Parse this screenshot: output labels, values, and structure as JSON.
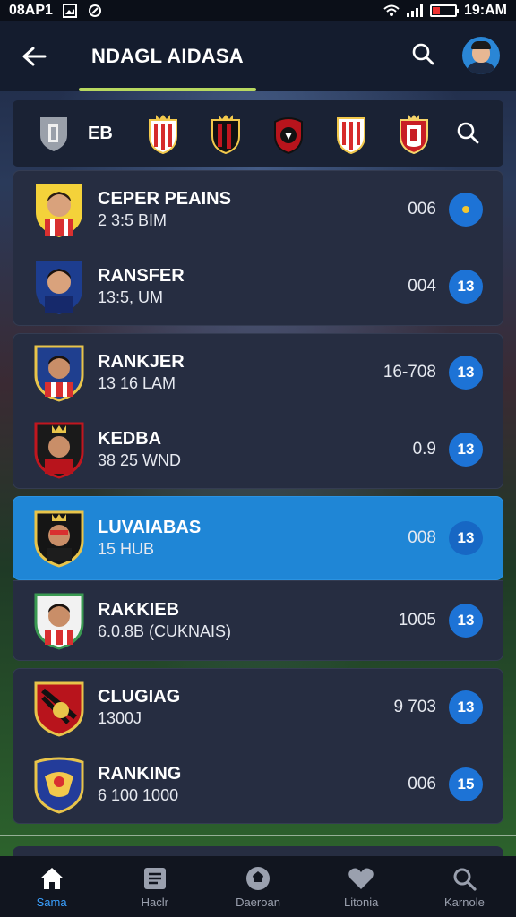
{
  "status_bar": {
    "time_left": "08AP1",
    "time_right": "19:AM"
  },
  "header": {
    "title": "NDAGL AIDASA"
  },
  "crest_bar": {
    "label": "EB",
    "crests": [
      {
        "name": "crest-1",
        "primary": "#d52b2b",
        "secondary": "#f2c94c"
      },
      {
        "name": "crest-2",
        "primary": "#c1161f",
        "secondary": "#111111"
      },
      {
        "name": "crest-3",
        "primary": "#b8141c",
        "secondary": "#111111"
      },
      {
        "name": "crest-4",
        "primary": "#d72b2b",
        "secondary": "#ffffff"
      },
      {
        "name": "crest-5",
        "primary": "#c81e25",
        "secondary": "#f5d46a"
      }
    ]
  },
  "list": {
    "groups": [
      {
        "highlight": false,
        "rows": [
          {
            "name": "CEPER PEAINS",
            "sub": "2 3:5 BIM",
            "value": "006",
            "pill": "",
            "badge": "yellow"
          },
          {
            "name": "RANSFER",
            "sub": "13:5, UM",
            "value": "004",
            "pill": "13",
            "badge": "navy"
          }
        ]
      },
      {
        "highlight": false,
        "rows": [
          {
            "name": "RANKJER",
            "sub": "13 16 LAM",
            "value": "16-708",
            "pill": "13",
            "badge": "red"
          },
          {
            "name": "KEDBA",
            "sub": "38 25 WND",
            "value": "0.9",
            "pill": "13",
            "badge": "black"
          }
        ]
      },
      {
        "highlight": true,
        "rows": [
          {
            "name": "LUVAIABAS",
            "sub": "15 HUB",
            "value": "008",
            "pill": "13",
            "badge": "black"
          }
        ]
      },
      {
        "highlight": false,
        "rows": [
          {
            "name": "RAKKIEB",
            "sub": "6.0.8B (CUKNAIS)",
            "value": "1005",
            "pill": "13",
            "badge": "white"
          }
        ]
      },
      {
        "highlight": false,
        "rows": [
          {
            "name": "CLUGIAG",
            "sub": "1300J",
            "value": "9   703",
            "pill": "13",
            "badge": "redstripe"
          },
          {
            "name": "RANKING",
            "sub": "6 100 1000",
            "value": "006",
            "pill": "15",
            "badge": "blueyellow"
          }
        ]
      }
    ]
  },
  "nav": {
    "items": [
      {
        "label": "Sama",
        "icon": "home-icon",
        "active": true
      },
      {
        "label": "Haclr",
        "icon": "document-icon",
        "active": false
      },
      {
        "label": "Daeroan",
        "icon": "soccer-ball-icon",
        "active": false
      },
      {
        "label": "Litonia",
        "icon": "heart-icon",
        "active": false
      },
      {
        "label": "Karnole",
        "icon": "search-icon",
        "active": false
      }
    ]
  },
  "colors": {
    "accent": "#1f86d6",
    "header": "#141c2e",
    "card": "#262d41",
    "underline": "#b8d860"
  }
}
